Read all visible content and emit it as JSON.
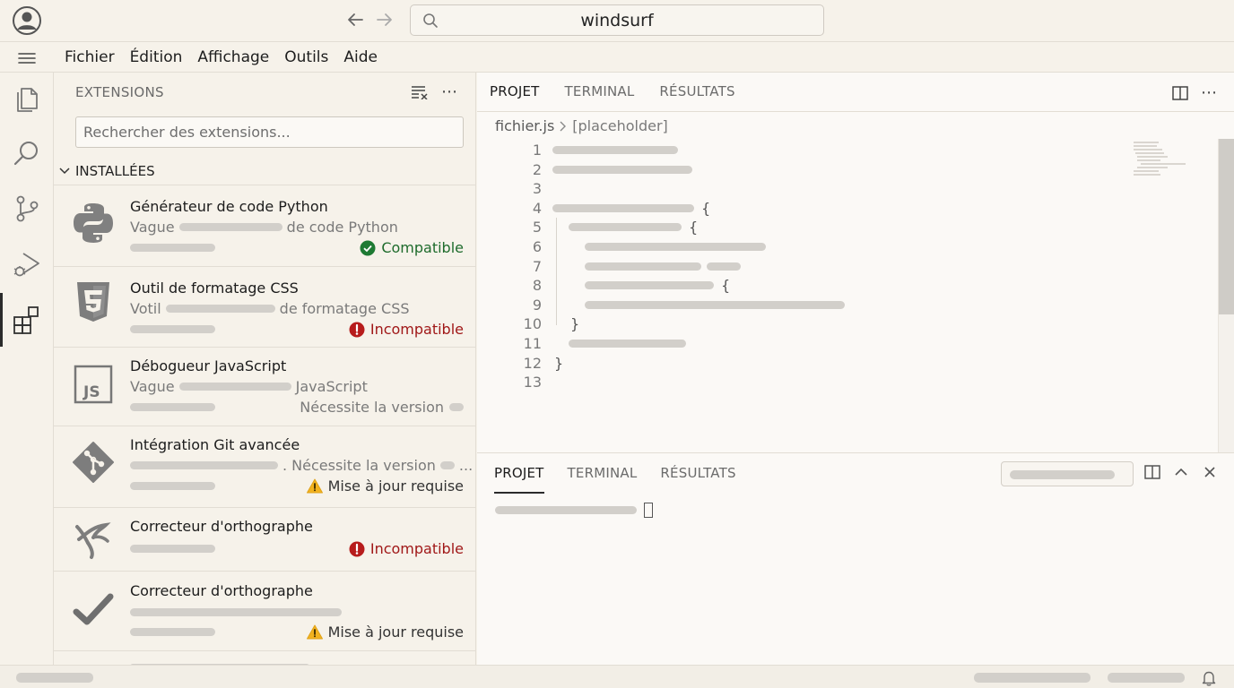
{
  "titlebar": {
    "search_text": "windsurf",
    "icons": [
      "account-icon",
      "arrow-left-icon",
      "arrow-right-icon",
      "search-icon"
    ]
  },
  "menu": {
    "items": [
      "Fichier",
      "Édition",
      "Affichage",
      "Outils",
      "Aide"
    ]
  },
  "activitybar": {
    "items": [
      "explorer-icon",
      "search-icon",
      "source-control-icon",
      "run-debug-icon",
      "extensions-icon"
    ],
    "active": "extensions-icon"
  },
  "sidebar": {
    "title": "EXTENSIONS",
    "search_placeholder": "Rechercher des extensions...",
    "section": "INSTALLÉES",
    "extensions": [
      {
        "icon": "python-icon",
        "name": "Générateur de code Python",
        "desc_prefix": "Vague",
        "desc_suffix": "de code Python",
        "status": "Compatible",
        "status_type": "ok"
      },
      {
        "icon": "css3-icon",
        "name": "Outil de formatage CSS",
        "desc_prefix": "Votil",
        "desc_suffix": "de formatage CSS",
        "status": "Incompatible",
        "status_type": "bad"
      },
      {
        "icon": "javascript-icon",
        "name": "Débogueur JavaScript",
        "desc_prefix": "Vague",
        "desc_suffix": "JavaScript",
        "status": "Nécessite la version",
        "status_type": "plain"
      },
      {
        "icon": "git-icon",
        "name": "Intégration Git avancée",
        "desc_suffix": ". Nécessite la version",
        "desc_ellipsis": "...",
        "status": "Mise à jour requise",
        "status_type": "warn"
      },
      {
        "icon": "spell-check-icon",
        "name": "Correcteur d'orthographe",
        "status": "Incompatible",
        "status_type": "bad"
      },
      {
        "icon": "checkmark-icon",
        "name": "Correcteur d'orthographe",
        "status": "Mise à jour requise",
        "status_type": "warn"
      }
    ]
  },
  "editor": {
    "tabs": [
      "PROJET",
      "TERMINAL",
      "RÉSULTATS"
    ],
    "active_tab": "PROJET",
    "breadcrumb": [
      "fichier.js",
      "[placeholder]"
    ],
    "line_numbers": [
      "1",
      "2",
      "3",
      "4",
      "5",
      "6",
      "7",
      "8",
      "9",
      "10",
      "11",
      "12",
      "13"
    ],
    "brace_open": "{",
    "brace_close": "}"
  },
  "panel": {
    "tabs": [
      "PROJET",
      "TERMINAL",
      "RÉSULTATS"
    ],
    "active_tab": "PROJET"
  },
  "colors": {
    "background": "#f6f2ea",
    "editor_background": "#fbf9f6",
    "compatible": "#1e6b2c",
    "incompatible": "#a01818",
    "warning": "#f2b21f"
  }
}
